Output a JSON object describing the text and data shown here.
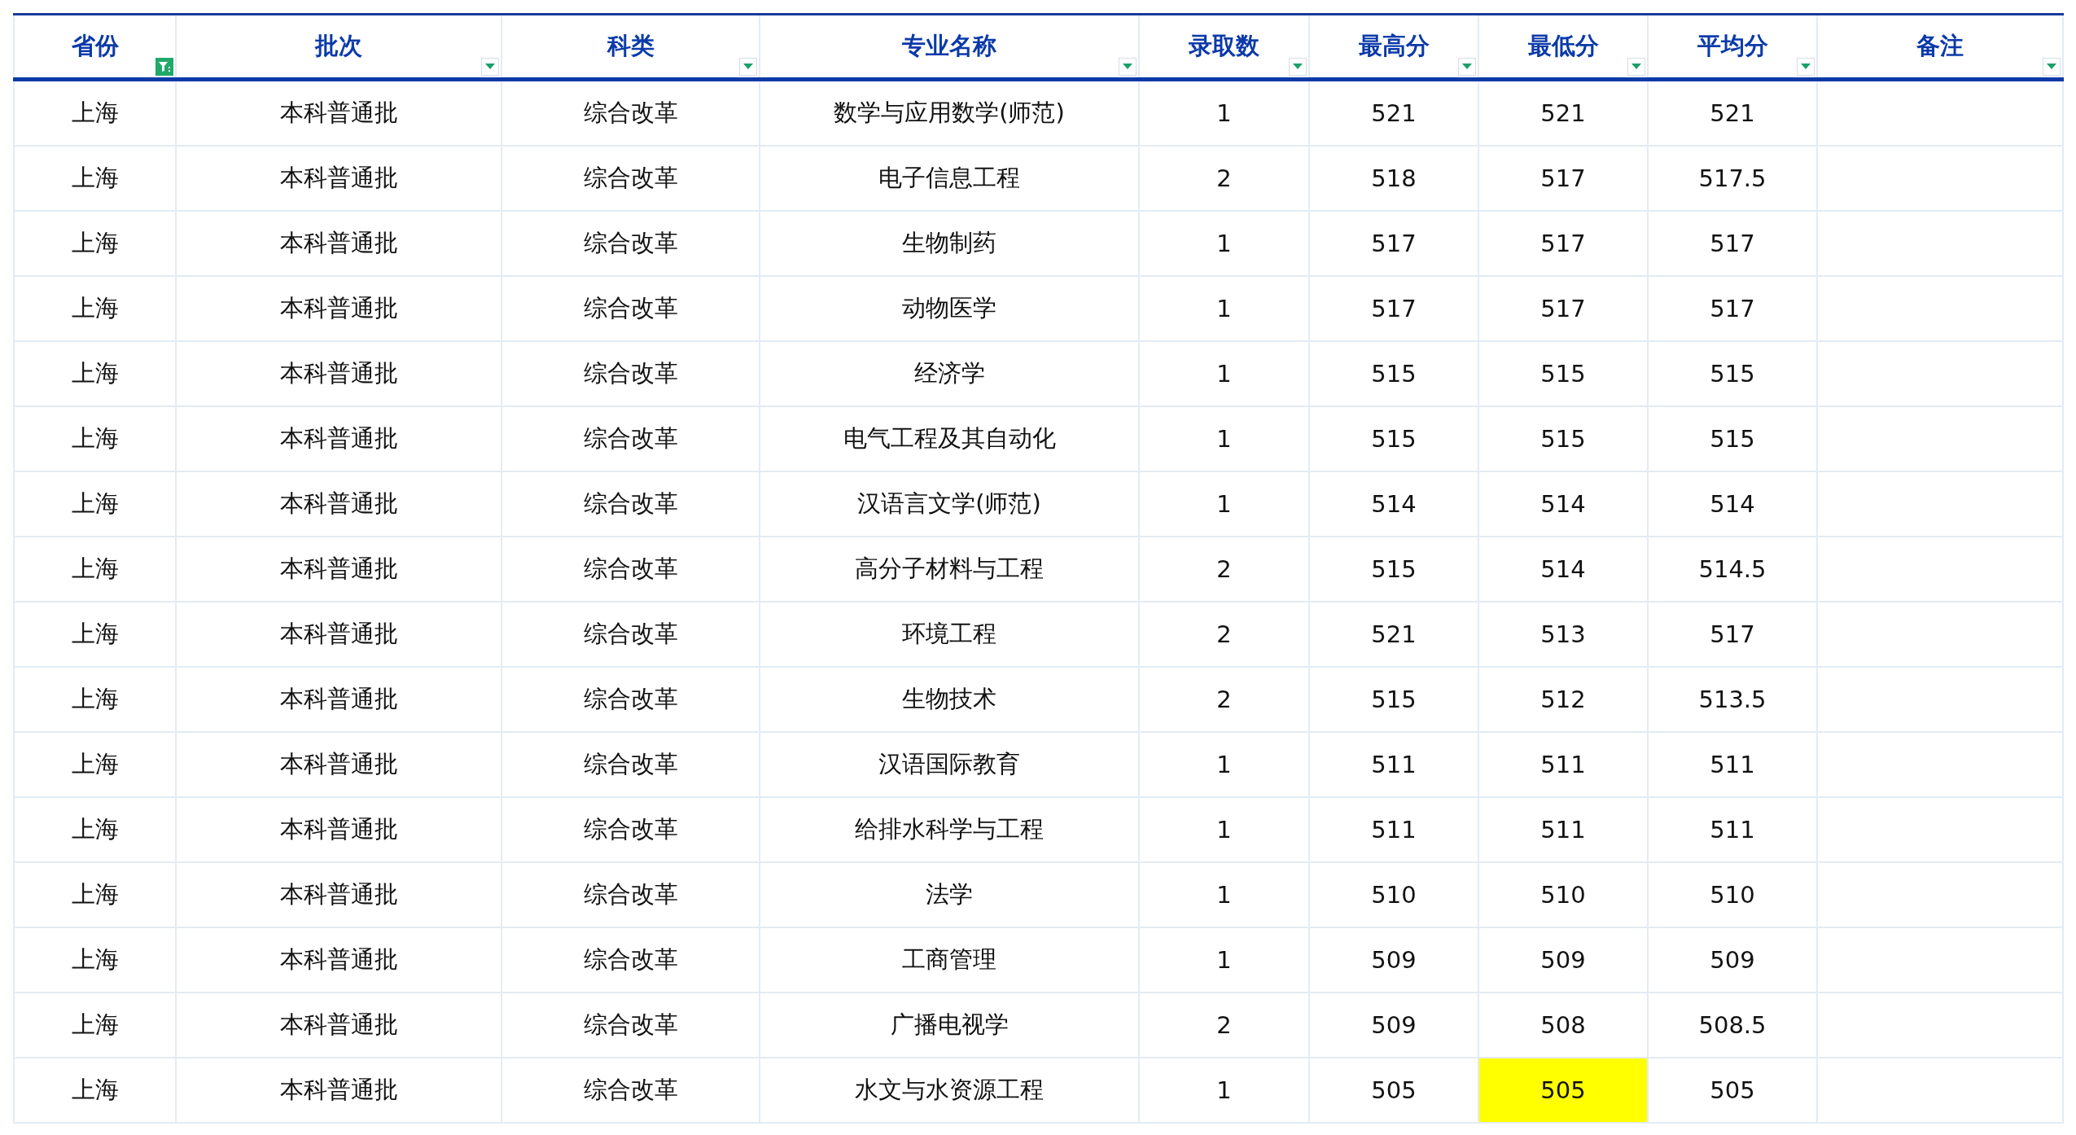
{
  "columns": [
    {
      "label": "省份",
      "filter_active": true
    },
    {
      "label": "批次",
      "filter_active": false
    },
    {
      "label": "科类",
      "filter_active": false
    },
    {
      "label": "专业名称",
      "filter_active": false
    },
    {
      "label": "录取数",
      "filter_active": false
    },
    {
      "label": "最高分",
      "filter_active": false
    },
    {
      "label": "最低分",
      "filter_active": false
    },
    {
      "label": "平均分",
      "filter_active": false
    },
    {
      "label": "备注",
      "filter_active": false
    }
  ],
  "rows": [
    {
      "cells": [
        {
          "text": "上海",
          "highlighted": false
        },
        {
          "text": "本科普通批",
          "highlighted": false
        },
        {
          "text": "综合改革",
          "highlighted": false
        },
        {
          "text": "数学与应用数学(师范)",
          "highlighted": false
        },
        {
          "text": "1",
          "highlighted": false
        },
        {
          "text": "521",
          "highlighted": false
        },
        {
          "text": "521",
          "highlighted": false
        },
        {
          "text": "521",
          "highlighted": false
        }
      ]
    },
    {
      "cells": [
        {
          "text": "上海",
          "highlighted": false
        },
        {
          "text": "本科普通批",
          "highlighted": false
        },
        {
          "text": "综合改革",
          "highlighted": false
        },
        {
          "text": "电子信息工程",
          "highlighted": false
        },
        {
          "text": "2",
          "highlighted": false
        },
        {
          "text": "518",
          "highlighted": false
        },
        {
          "text": "517",
          "highlighted": false
        },
        {
          "text": "517.5",
          "highlighted": false
        }
      ]
    },
    {
      "cells": [
        {
          "text": "上海",
          "highlighted": false
        },
        {
          "text": "本科普通批",
          "highlighted": false
        },
        {
          "text": "综合改革",
          "highlighted": false
        },
        {
          "text": "生物制药",
          "highlighted": false
        },
        {
          "text": "1",
          "highlighted": false
        },
        {
          "text": "517",
          "highlighted": false
        },
        {
          "text": "517",
          "highlighted": false
        },
        {
          "text": "517",
          "highlighted": false
        }
      ]
    },
    {
      "cells": [
        {
          "text": "上海",
          "highlighted": false
        },
        {
          "text": "本科普通批",
          "highlighted": false
        },
        {
          "text": "综合改革",
          "highlighted": false
        },
        {
          "text": "动物医学",
          "highlighted": false
        },
        {
          "text": "1",
          "highlighted": false
        },
        {
          "text": "517",
          "highlighted": false
        },
        {
          "text": "517",
          "highlighted": false
        },
        {
          "text": "517",
          "highlighted": false
        }
      ]
    },
    {
      "cells": [
        {
          "text": "上海",
          "highlighted": false
        },
        {
          "text": "本科普通批",
          "highlighted": false
        },
        {
          "text": "综合改革",
          "highlighted": false
        },
        {
          "text": "经济学",
          "highlighted": false
        },
        {
          "text": "1",
          "highlighted": false
        },
        {
          "text": "515",
          "highlighted": false
        },
        {
          "text": "515",
          "highlighted": false
        },
        {
          "text": "515",
          "highlighted": false
        }
      ]
    },
    {
      "cells": [
        {
          "text": "上海",
          "highlighted": false
        },
        {
          "text": "本科普通批",
          "highlighted": false
        },
        {
          "text": "综合改革",
          "highlighted": false
        },
        {
          "text": "电气工程及其自动化",
          "highlighted": false
        },
        {
          "text": "1",
          "highlighted": false
        },
        {
          "text": "515",
          "highlighted": false
        },
        {
          "text": "515",
          "highlighted": false
        },
        {
          "text": "515",
          "highlighted": false
        }
      ]
    },
    {
      "cells": [
        {
          "text": "上海",
          "highlighted": false
        },
        {
          "text": "本科普通批",
          "highlighted": false
        },
        {
          "text": "综合改革",
          "highlighted": false
        },
        {
          "text": "汉语言文学(师范)",
          "highlighted": false
        },
        {
          "text": "1",
          "highlighted": false
        },
        {
          "text": "514",
          "highlighted": false
        },
        {
          "text": "514",
          "highlighted": false
        },
        {
          "text": "514",
          "highlighted": false
        }
      ]
    },
    {
      "cells": [
        {
          "text": "上海",
          "highlighted": false
        },
        {
          "text": "本科普通批",
          "highlighted": false
        },
        {
          "text": "综合改革",
          "highlighted": false
        },
        {
          "text": "高分子材料与工程",
          "highlighted": false
        },
        {
          "text": "2",
          "highlighted": false
        },
        {
          "text": "515",
          "highlighted": false
        },
        {
          "text": "514",
          "highlighted": false
        },
        {
          "text": "514.5",
          "highlighted": false
        }
      ]
    },
    {
      "cells": [
        {
          "text": "上海",
          "highlighted": false
        },
        {
          "text": "本科普通批",
          "highlighted": false
        },
        {
          "text": "综合改革",
          "highlighted": false
        },
        {
          "text": "环境工程",
          "highlighted": false
        },
        {
          "text": "2",
          "highlighted": false
        },
        {
          "text": "521",
          "highlighted": false
        },
        {
          "text": "513",
          "highlighted": false
        },
        {
          "text": "517",
          "highlighted": false
        }
      ]
    },
    {
      "cells": [
        {
          "text": "上海",
          "highlighted": false
        },
        {
          "text": "本科普通批",
          "highlighted": false
        },
        {
          "text": "综合改革",
          "highlighted": false
        },
        {
          "text": "生物技术",
          "highlighted": false
        },
        {
          "text": "2",
          "highlighted": false
        },
        {
          "text": "515",
          "highlighted": false
        },
        {
          "text": "512",
          "highlighted": false
        },
        {
          "text": "513.5",
          "highlighted": false
        }
      ]
    },
    {
      "cells": [
        {
          "text": "上海",
          "highlighted": false
        },
        {
          "text": "本科普通批",
          "highlighted": false
        },
        {
          "text": "综合改革",
          "highlighted": false
        },
        {
          "text": "汉语国际教育",
          "highlighted": false
        },
        {
          "text": "1",
          "highlighted": false
        },
        {
          "text": "511",
          "highlighted": false
        },
        {
          "text": "511",
          "highlighted": false
        },
        {
          "text": "511",
          "highlighted": false
        }
      ]
    },
    {
      "cells": [
        {
          "text": "上海",
          "highlighted": false
        },
        {
          "text": "本科普通批",
          "highlighted": false
        },
        {
          "text": "综合改革",
          "highlighted": false
        },
        {
          "text": "给排水科学与工程",
          "highlighted": false
        },
        {
          "text": "1",
          "highlighted": false
        },
        {
          "text": "511",
          "highlighted": false
        },
        {
          "text": "511",
          "highlighted": false
        },
        {
          "text": "511",
          "highlighted": false
        }
      ]
    },
    {
      "cells": [
        {
          "text": "上海",
          "highlighted": false
        },
        {
          "text": "本科普通批",
          "highlighted": false
        },
        {
          "text": "综合改革",
          "highlighted": false
        },
        {
          "text": "法学",
          "highlighted": false
        },
        {
          "text": "1",
          "highlighted": false
        },
        {
          "text": "510",
          "highlighted": false
        },
        {
          "text": "510",
          "highlighted": false
        },
        {
          "text": "510",
          "highlighted": false
        }
      ]
    },
    {
      "cells": [
        {
          "text": "上海",
          "highlighted": false
        },
        {
          "text": "本科普通批",
          "highlighted": false
        },
        {
          "text": "综合改革",
          "highlighted": false
        },
        {
          "text": "工商管理",
          "highlighted": false
        },
        {
          "text": "1",
          "highlighted": false
        },
        {
          "text": "509",
          "highlighted": false
        },
        {
          "text": "509",
          "highlighted": false
        },
        {
          "text": "509",
          "highlighted": false
        }
      ]
    },
    {
      "cells": [
        {
          "text": "上海",
          "highlighted": false
        },
        {
          "text": "本科普通批",
          "highlighted": false
        },
        {
          "text": "综合改革",
          "highlighted": false
        },
        {
          "text": "广播电视学",
          "highlighted": false
        },
        {
          "text": "2",
          "highlighted": false
        },
        {
          "text": "509",
          "highlighted": false
        },
        {
          "text": "508",
          "highlighted": false
        },
        {
          "text": "508.5",
          "highlighted": false
        }
      ]
    },
    {
      "cells": [
        {
          "text": "上海",
          "highlighted": false
        },
        {
          "text": "本科普通批",
          "highlighted": false
        },
        {
          "text": "综合改革",
          "highlighted": false
        },
        {
          "text": "水文与水资源工程",
          "highlighted": false
        },
        {
          "text": "1",
          "highlighted": false
        },
        {
          "text": "505",
          "highlighted": false
        },
        {
          "text": "505",
          "highlighted": true
        },
        {
          "text": "505",
          "highlighted": false
        }
      ]
    }
  ]
}
